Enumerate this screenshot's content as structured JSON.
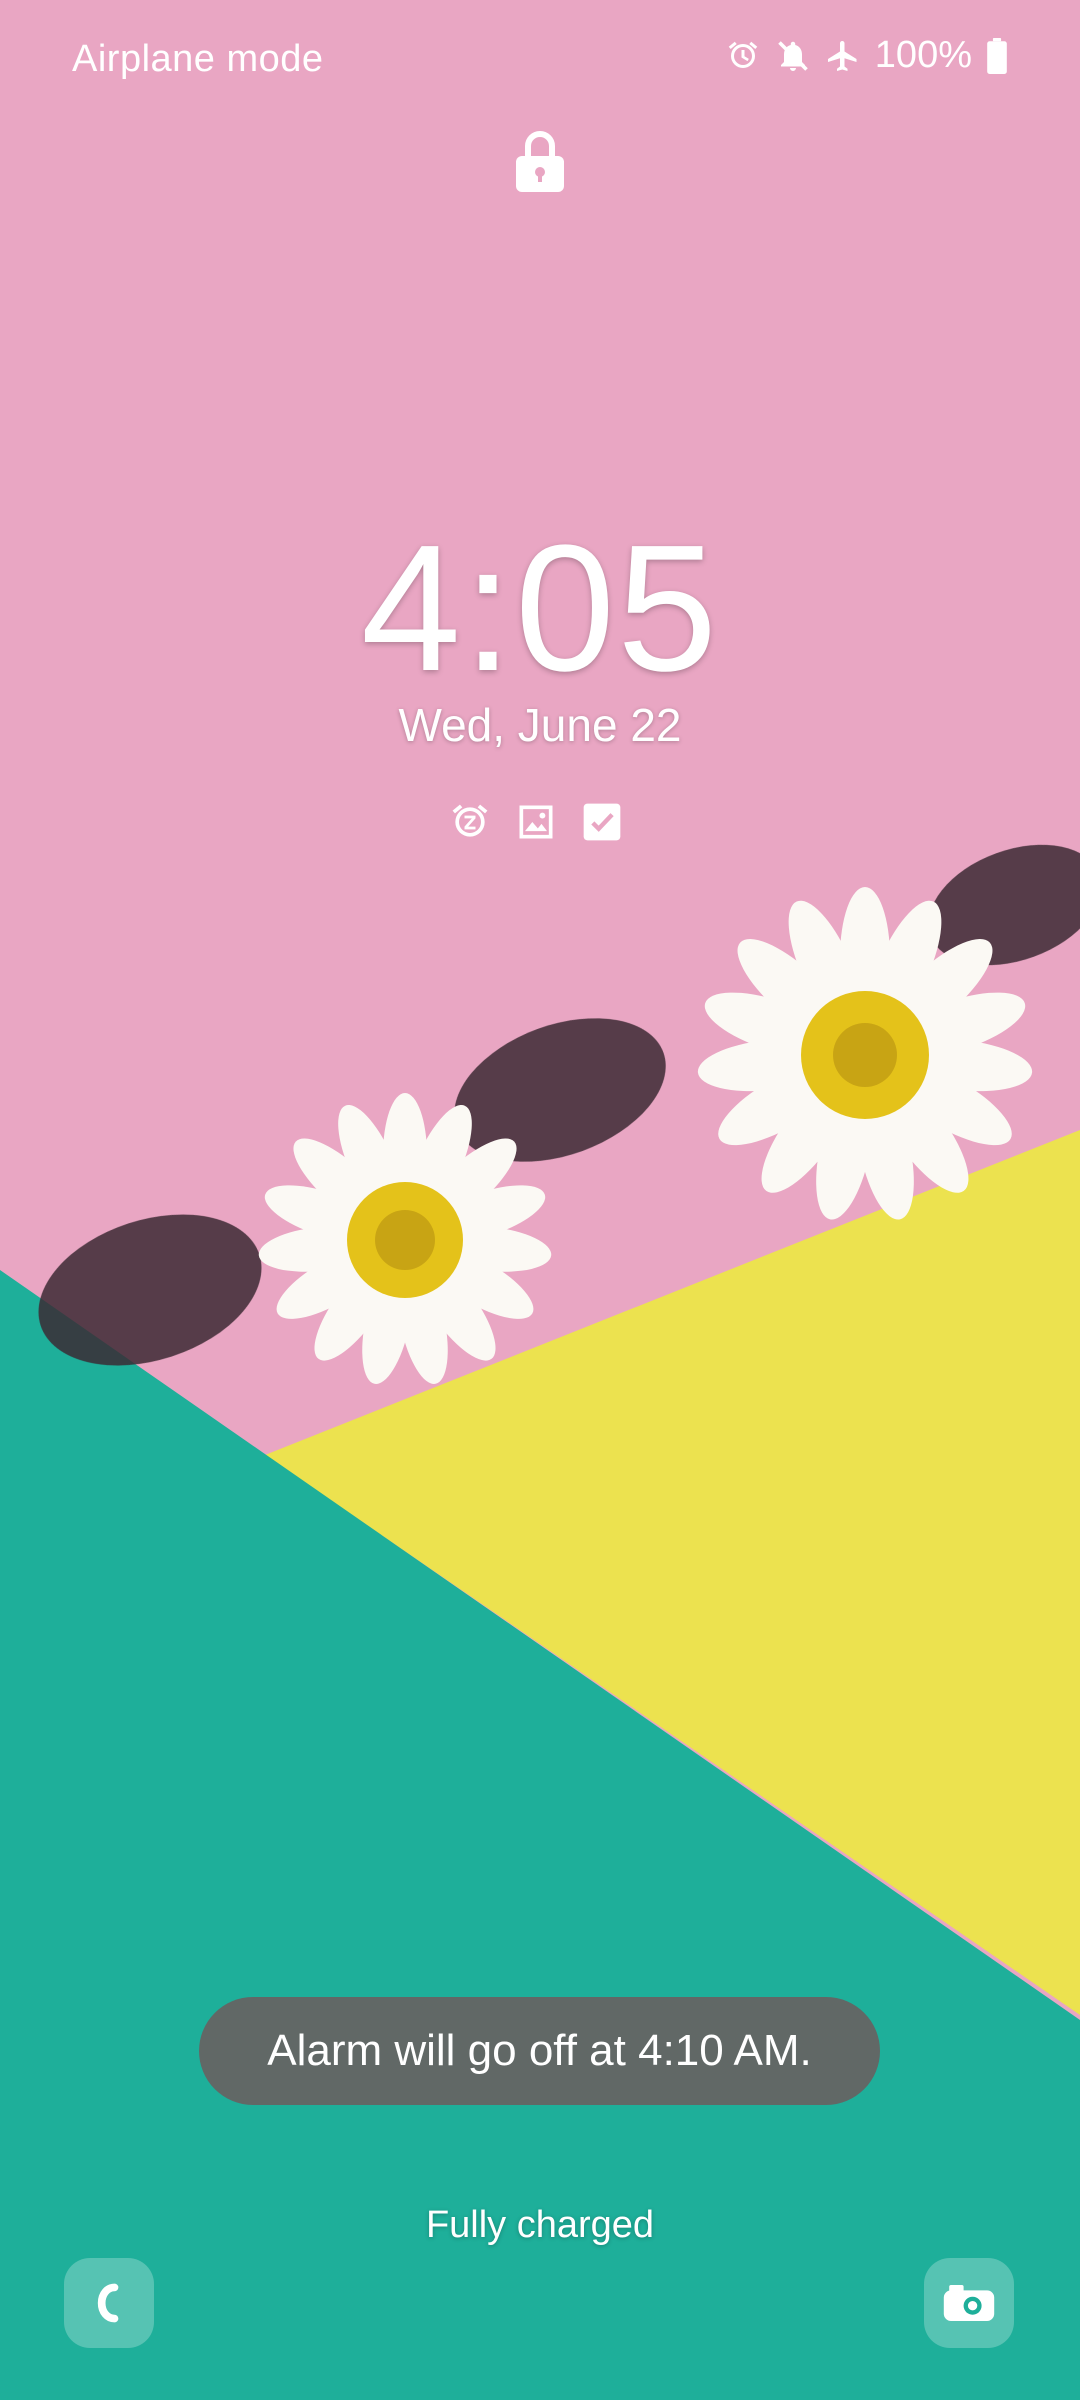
{
  "status_bar": {
    "network_label": "Airplane mode",
    "battery": "100%",
    "icons": [
      "alarm-icon",
      "mute-icon",
      "airplane-icon",
      "battery-icon"
    ]
  },
  "lock": {
    "icon": "lock-icon"
  },
  "clock": {
    "time": "4:05",
    "date": "Wed, June 22"
  },
  "widgets": {
    "icons": [
      "alarm-snooze-icon",
      "gallery-icon",
      "checklist-icon"
    ]
  },
  "toast": {
    "text": "Alarm will go off at 4:10 AM."
  },
  "charging": {
    "text": "Fully charged"
  },
  "shortcuts": {
    "left": "phone-icon",
    "right": "camera-icon"
  },
  "colors": {
    "pink": "#e9a6c3",
    "yellow": "#ece24f",
    "teal": "#1eaf9a",
    "toast": "#616866"
  }
}
